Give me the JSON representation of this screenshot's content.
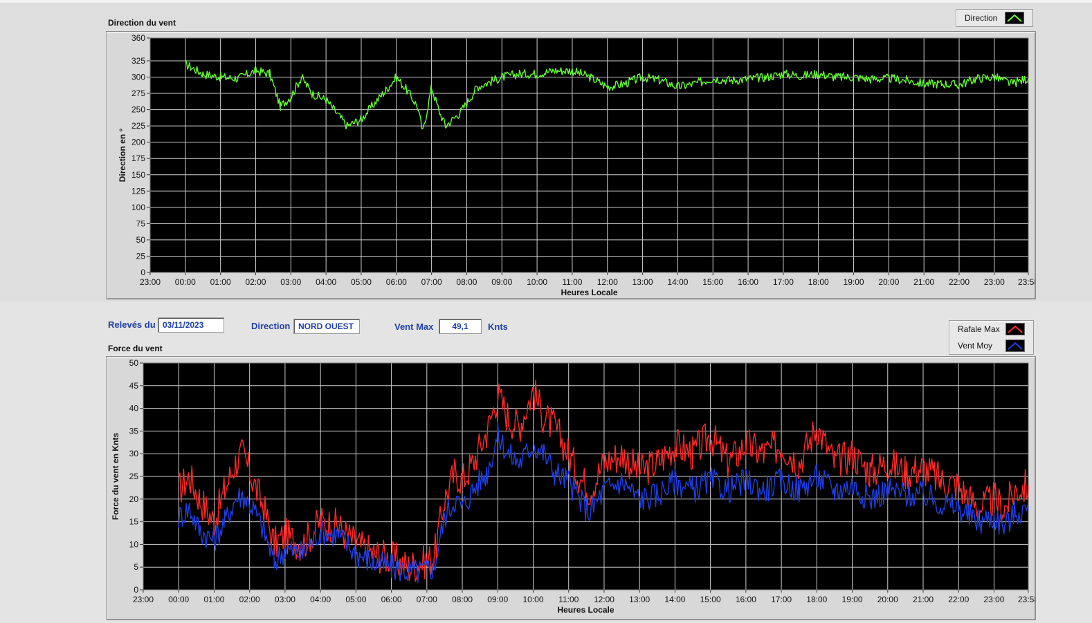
{
  "direction_panel": {
    "title": "Direction du vent",
    "legend": [
      {
        "name": "Direction",
        "color": "#66ff33"
      }
    ]
  },
  "force_panel": {
    "title": "Force du vent",
    "legend": [
      {
        "name": "Rafale Max",
        "color": "#ff2a2a"
      },
      {
        "name": "Vent Moy",
        "color": "#1f3fe6"
      }
    ]
  },
  "info": {
    "date_label": "Relevés du",
    "date_value": "03/11/2023",
    "direction_label": "Direction",
    "direction_value": "NORD OUEST",
    "ventmax_label": "Vent Max",
    "ventmax_value": "49,1",
    "ventmax_unit": "Knts"
  },
  "chart_data": [
    {
      "type": "line",
      "title": "Direction du vent",
      "xlabel": "Heures Locale",
      "ylabel": "Direction en °",
      "ylim": [
        0,
        360
      ],
      "yticks": [
        0,
        25,
        50,
        75,
        100,
        125,
        150,
        175,
        200,
        225,
        250,
        275,
        300,
        325,
        360
      ],
      "xlim": [
        -1,
        23.967
      ],
      "xticks": [
        -1,
        0,
        1,
        2,
        3,
        4,
        5,
        6,
        7,
        8,
        9,
        10,
        11,
        12,
        13,
        14,
        15,
        16,
        17,
        18,
        19,
        20,
        21,
        22,
        23,
        23.967
      ],
      "xtick_labels": [
        "23:00",
        "00:00",
        "01:00",
        "02:00",
        "03:00",
        "04:00",
        "05:00",
        "06:00",
        "07:00",
        "08:00",
        "09:00",
        "10:00",
        "11:00",
        "12:00",
        "13:00",
        "14:00",
        "15:00",
        "16:00",
        "17:00",
        "18:00",
        "19:00",
        "20:00",
        "21:00",
        "22:00",
        "23:00",
        "23:58"
      ],
      "grid": true,
      "legend_position": "top-right",
      "series": [
        {
          "name": "Direction",
          "color": "#66ff33",
          "x": [
            0,
            0.5,
            1,
            1.5,
            2,
            2.4,
            2.7,
            3,
            3.3,
            3.6,
            4,
            4.3,
            4.6,
            5,
            5.3,
            5.7,
            6,
            6.3,
            6.6,
            6.75,
            7,
            7.2,
            7.4,
            7.8,
            8,
            8.3,
            9,
            9.5,
            10,
            10.5,
            11,
            11.5,
            12,
            12.5,
            13,
            13.5,
            14,
            14.5,
            15,
            15.5,
            16,
            16.5,
            17,
            17.5,
            18,
            18.5,
            19,
            19.5,
            20,
            20.5,
            21,
            21.5,
            22,
            22.5,
            23,
            23.5,
            23.967
          ],
          "y": [
            320,
            305,
            300,
            298,
            310,
            305,
            255,
            270,
            300,
            275,
            265,
            245,
            225,
            235,
            255,
            280,
            300,
            280,
            255,
            215,
            285,
            250,
            225,
            245,
            260,
            285,
            300,
            305,
            305,
            310,
            310,
            300,
            285,
            290,
            300,
            295,
            285,
            290,
            298,
            295,
            297,
            300,
            305,
            302,
            305,
            300,
            300,
            297,
            298,
            295,
            290,
            290,
            288,
            298,
            300,
            290,
            298
          ]
        }
      ]
    },
    {
      "type": "line",
      "title": "Force du vent",
      "xlabel": "Heures Locale",
      "ylabel": "Force du vent en Knts",
      "ylim": [
        0,
        50
      ],
      "yticks": [
        0,
        5,
        10,
        15,
        20,
        25,
        30,
        35,
        40,
        45,
        50
      ],
      "xlim": [
        -1,
        23.967
      ],
      "xticks": [
        -1,
        0,
        1,
        2,
        3,
        4,
        5,
        6,
        7,
        8,
        9,
        10,
        11,
        12,
        13,
        14,
        15,
        16,
        17,
        18,
        19,
        20,
        21,
        22,
        23,
        23.967
      ],
      "xtick_labels": [
        "23:00",
        "00:00",
        "01:00",
        "02:00",
        "03:00",
        "04:00",
        "05:00",
        "06:00",
        "07:00",
        "08:00",
        "09:00",
        "10:00",
        "11:00",
        "12:00",
        "13:00",
        "14:00",
        "15:00",
        "16:00",
        "17:00",
        "18:00",
        "19:00",
        "20:00",
        "21:00",
        "22:00",
        "23:00",
        "23:58"
      ],
      "grid": true,
      "legend_position": "top-right",
      "series": [
        {
          "name": "Rafale Max",
          "color": "#ff2a2a",
          "x": [
            0,
            0.3,
            0.6,
            1,
            1.3,
            1.6,
            1.8,
            2.1,
            2.4,
            2.7,
            3,
            3.5,
            4,
            4.5,
            5,
            5.5,
            6,
            6.5,
            6.8,
            7.2,
            7.5,
            7.8,
            8,
            8.3,
            8.7,
            9,
            9.3,
            9.6,
            10,
            10.3,
            10.6,
            11,
            11.3,
            11.6,
            12,
            12.5,
            13,
            13.5,
            14,
            14.5,
            15,
            15.5,
            16,
            16.5,
            17,
            17.5,
            18,
            18.5,
            19,
            19.5,
            20,
            20.5,
            21,
            21.5,
            22,
            22.3,
            22.6,
            23,
            23.3,
            23.6,
            23.967
          ],
          "y": [
            22,
            25,
            20,
            15,
            22,
            28,
            30,
            24,
            18,
            10,
            12,
            10,
            15,
            14,
            10,
            8,
            7,
            5,
            6,
            7,
            20,
            26,
            24,
            28,
            35,
            43,
            38,
            36,
            44,
            38,
            36,
            30,
            25,
            22,
            28,
            30,
            26,
            28,
            32,
            30,
            34,
            28,
            32,
            30,
            32,
            28,
            36,
            28,
            30,
            26,
            28,
            26,
            27,
            24,
            23,
            20,
            18,
            20,
            18,
            22,
            23
          ]
        },
        {
          "name": "Vent Moy",
          "color": "#1f3fe6",
          "x": [
            0,
            0.3,
            0.6,
            1,
            1.3,
            1.6,
            1.8,
            2.1,
            2.4,
            2.7,
            3,
            3.5,
            4,
            4.5,
            5,
            5.5,
            6,
            6.5,
            6.8,
            7.2,
            7.5,
            7.8,
            8,
            8.3,
            8.7,
            9,
            9.3,
            9.6,
            10,
            10.3,
            10.6,
            11,
            11.3,
            11.6,
            12,
            12.5,
            13,
            13.5,
            14,
            14.5,
            15,
            15.5,
            16,
            16.5,
            17,
            17.5,
            18,
            18.5,
            19,
            19.5,
            20,
            20.5,
            21,
            21.5,
            22,
            22.3,
            22.6,
            23,
            23.3,
            23.6,
            23.967
          ],
          "y": [
            16,
            18,
            13,
            11,
            15,
            20,
            21,
            18,
            13,
            6,
            9,
            8,
            13,
            12,
            8,
            6,
            5,
            4,
            4,
            5,
            16,
            20,
            18,
            22,
            26,
            34,
            30,
            28,
            32,
            30,
            26,
            24,
            20,
            17,
            22,
            24,
            20,
            21,
            24,
            22,
            24,
            22,
            24,
            22,
            24,
            22,
            25,
            22,
            23,
            20,
            22,
            21,
            21,
            19,
            18,
            16,
            15,
            16,
            14,
            17,
            18
          ]
        }
      ]
    }
  ]
}
